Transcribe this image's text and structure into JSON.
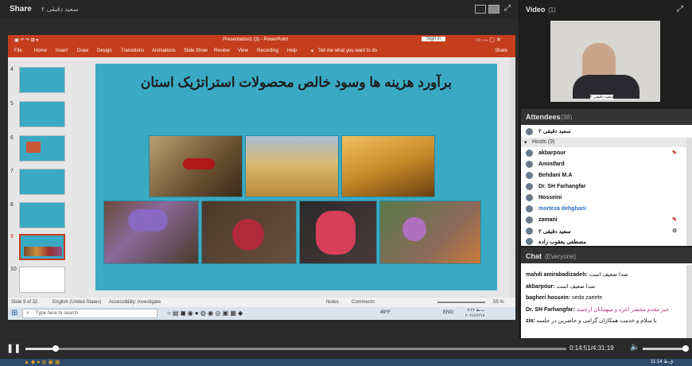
{
  "share": {
    "title": "Share",
    "presenter": "سعید دقیقی ۲"
  },
  "ppt": {
    "window_title": "Presentation1 (3) - PowerPoint",
    "sign_in": "Sign in",
    "menu": [
      "File",
      "Home",
      "Insert",
      "Draw",
      "Design",
      "Transitions",
      "Animations",
      "Slide Show",
      "Review",
      "View",
      "Recording",
      "Help"
    ],
    "tell_me": "Tell me what you want to do",
    "share_btn": "Share",
    "slide_numbers": [
      "4",
      "5",
      "6",
      "7",
      "8",
      "9",
      "10"
    ],
    "slide_title": "برآورد هزینه ها وسود خالص محصولات استراتژیک استان",
    "status_slide": "Slide 9 of 32",
    "status_lang": "English (United States)",
    "status_access": "Accessibility: Investigate",
    "notes": "Notes",
    "comments": "Comments",
    "zoom": "55 %"
  },
  "taskbar": {
    "search_placeholder": "Type here to search",
    "temp": "49°F",
    "lang": "ENG",
    "time": "۰۷:۲۲ ب.ظ",
    "date": "۲۰۲۱/۱۲/۱۷"
  },
  "video": {
    "title": "Video",
    "count": "(1)",
    "caption": "سعید دقیقی ۲"
  },
  "attendees": {
    "title": "Attendees",
    "count": "(38)",
    "self": "سعید دقیقی ۲",
    "hosts_label": "Hosts (9)",
    "hosts": [
      "akbarpour",
      "Aminifard",
      "Behdani M.A",
      "Dr. SH Farhangfar",
      "Hosseini",
      "morteza dehghani",
      "zamani",
      "سعید دقیقی ۲",
      "مصطفی یعقوب زاده"
    ]
  },
  "chat": {
    "title": "Chat",
    "scope": "(Everyone)",
    "messages": [
      {
        "sender": "mahdi amirabadizadeh:",
        "text": "صدا ضعیف است"
      },
      {
        "sender": "akbarpour:",
        "text": "صدا ضعیف است"
      },
      {
        "sender": "bagheri hossein:",
        "text": "seda zaeefe"
      },
      {
        "sender": "Dr. SH Farhangfar:",
        "text": "خیر مقدم محضر اعزه و میهمانان ارجمند"
      },
      {
        "sender": "zia:",
        "text": "با سلام و خدمت همکاران گرامی و حاضرین در جلسه"
      }
    ]
  },
  "player": {
    "time": "0:14:51/4:31:19"
  },
  "windows_clock": "11:14 ق.ظ",
  "colors": {
    "ppt_red": "#c43e1c",
    "slide_teal": "#3aaac4",
    "chat_pink": "#c0307a",
    "host_blue": "#2a6fc0"
  }
}
